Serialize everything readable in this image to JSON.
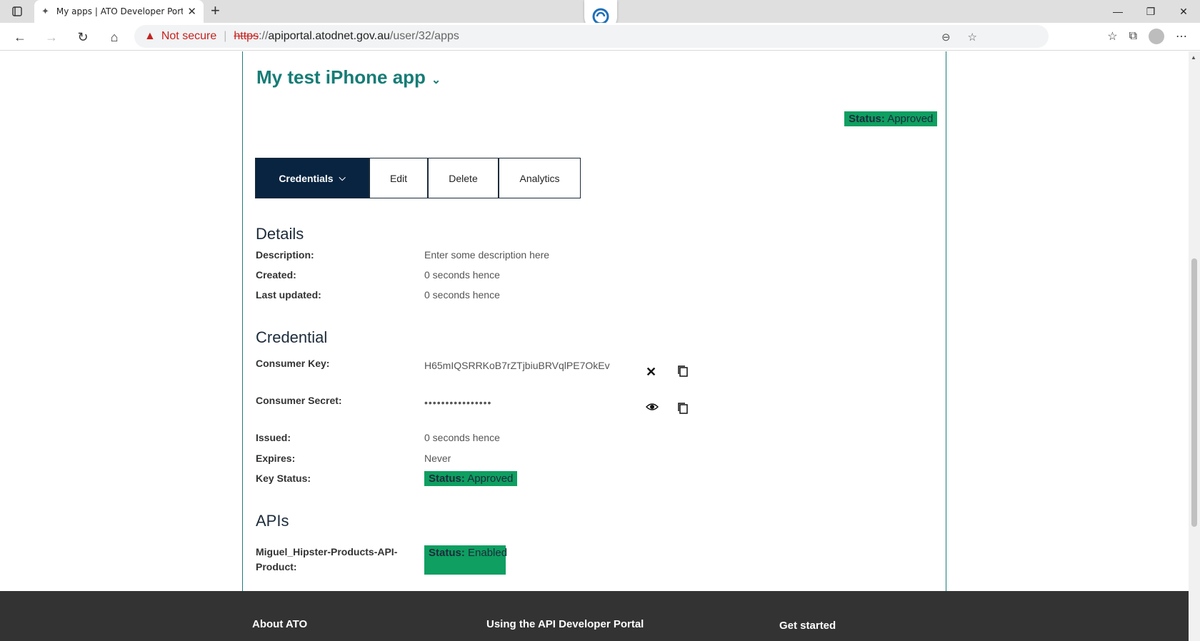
{
  "browser": {
    "tab_title": "My apps | ATO Developer Portal",
    "not_secure": "Not secure",
    "url_scheme": "https",
    "url_sep": "://",
    "url_host": "apiportal.atodnet.gov.au",
    "url_path": "/user/32/apps"
  },
  "app": {
    "title": "My test iPhone app",
    "status_label": "Status:",
    "status_value": "Approved"
  },
  "tabs": {
    "credentials": "Credentials",
    "edit": "Edit",
    "delete": "Delete",
    "analytics": "Analytics"
  },
  "details": {
    "heading": "Details",
    "description_label": "Description:",
    "description_value": "Enter some description here",
    "created_label": "Created:",
    "created_value": "0 seconds hence",
    "updated_label": "Last updated:",
    "updated_value": "0 seconds hence"
  },
  "credential": {
    "heading": "Credential",
    "key_label": "Consumer Key:",
    "key_value": "H65mIQSRRKoB7rZTjbiuBRVqlPE7OkEv",
    "secret_label": "Consumer Secret:",
    "secret_value": "••••••••••••••••",
    "issued_label": "Issued:",
    "issued_value": "0 seconds hence",
    "expires_label": "Expires:",
    "expires_value": "Never",
    "keystatus_label": "Key Status:",
    "keystatus_status_label": "Status:",
    "keystatus_status_value": "Approved"
  },
  "apis": {
    "heading": "APIs",
    "product_label_1": "Miguel_Hipster-Products-API-",
    "product_label_2": "Product:",
    "status_label": "Status:",
    "status_value": "Enabled"
  },
  "footer": {
    "about": "About ATO",
    "using": "Using the API Developer Portal",
    "started": "Get started"
  }
}
